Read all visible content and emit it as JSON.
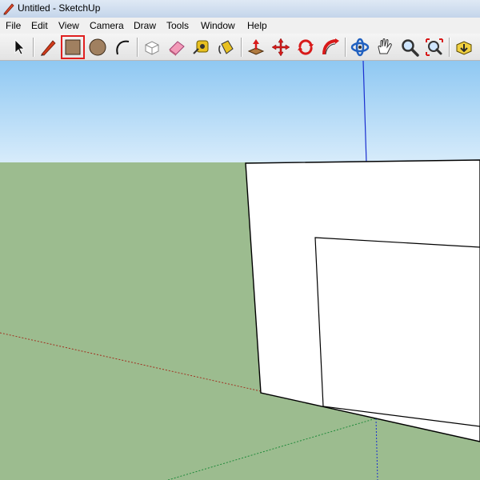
{
  "window": {
    "title": "Untitled - SketchUp"
  },
  "menu": {
    "items": [
      {
        "label": "File"
      },
      {
        "label": "Edit"
      },
      {
        "label": "View"
      },
      {
        "label": "Camera"
      },
      {
        "label": "Draw"
      },
      {
        "label": "Tools"
      },
      {
        "label": "Window"
      },
      {
        "label": "Help"
      }
    ]
  },
  "toolbar": {
    "selected_tool": "rectangle",
    "tools": [
      {
        "name": "select"
      },
      {
        "name": "line"
      },
      {
        "name": "rectangle"
      },
      {
        "name": "circle"
      },
      {
        "name": "arc"
      },
      {
        "name": "make-component"
      },
      {
        "name": "eraser"
      },
      {
        "name": "tape-measure"
      },
      {
        "name": "paint-bucket"
      },
      {
        "name": "push-pull"
      },
      {
        "name": "move"
      },
      {
        "name": "rotate"
      },
      {
        "name": "follow-me"
      },
      {
        "name": "orbit"
      },
      {
        "name": "pan"
      },
      {
        "name": "zoom"
      },
      {
        "name": "zoom-extents"
      },
      {
        "name": "get-models"
      }
    ]
  },
  "scene": {
    "sky_color": "#a9d4f5",
    "ground_color": "#9cbc8f",
    "face_color": "#ffffff",
    "axis_colors": {
      "red": "#a03020",
      "green": "#1f8a3a",
      "blue": "#1a2fd0"
    }
  }
}
